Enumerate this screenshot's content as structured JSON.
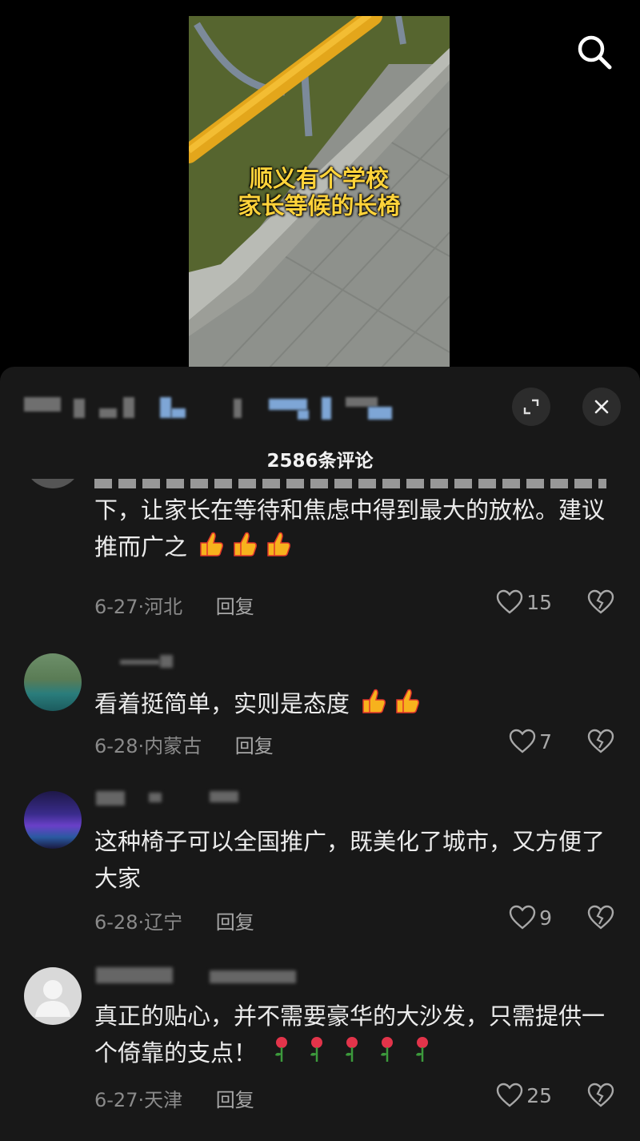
{
  "video": {
    "caption_line1": "顺义有个学校",
    "caption_line2": "家长等候的长椅"
  },
  "sheet": {
    "comment_count": "2586条评论"
  },
  "comments": [
    {
      "text": "下，让家长在等待和焦虑中得到最大的放松。建议推而广之",
      "emoji": "thumbs-up x3",
      "date": "6-27",
      "sep": "·",
      "region": "河北",
      "reply": "回复",
      "likes": "15"
    },
    {
      "text": "看着挺简单，实则是态度",
      "emoji": "thumbs-up x2",
      "date": "6-28",
      "sep": "·",
      "region": "内蒙古",
      "reply": "回复",
      "likes": "7"
    },
    {
      "text": "这种椅子可以全国推广，既美化了城市，又方便了大家",
      "date": "6-28",
      "sep": "·",
      "region": "辽宁",
      "reply": "回复",
      "likes": "9"
    },
    {
      "text": "真正的贴心，并不需要豪华的大沙发，只需提供一个倚靠的支点！",
      "emoji": "rose x5",
      "date": "6-27",
      "sep": "·",
      "region": "天津",
      "reply": "回复",
      "likes": "25"
    }
  ],
  "icons": {
    "search": "search-icon",
    "expand": "expand-icon",
    "close": "close-icon",
    "like": "heart-outline-icon",
    "dislike": "broken-heart-icon"
  },
  "colors": {
    "caption": "#ffd33a",
    "sheet_bg": "#181818",
    "muted": "#8a8a8a"
  }
}
